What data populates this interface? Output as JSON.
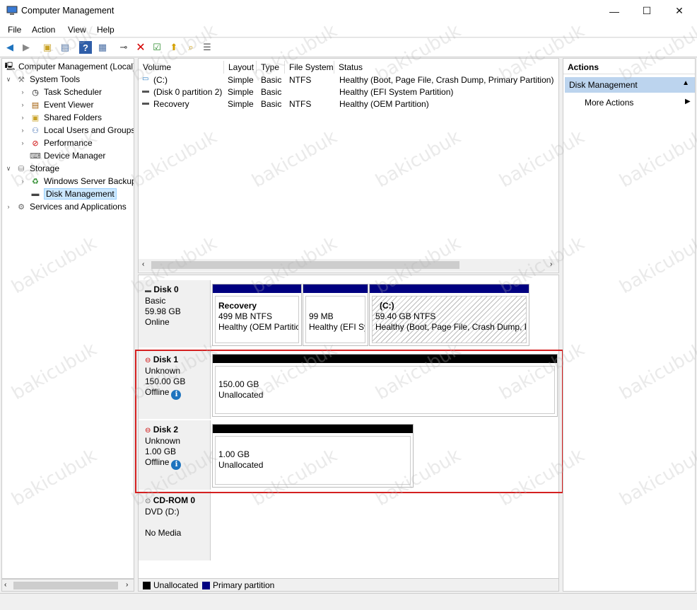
{
  "window": {
    "title": "Computer Management",
    "minimize": "—",
    "maximize": "☐",
    "close": "✕"
  },
  "menu": [
    "File",
    "Action",
    "View",
    "Help"
  ],
  "tree": {
    "root": "Computer Management (Local)",
    "system_tools": "System Tools",
    "task_scheduler": "Task Scheduler",
    "event_viewer": "Event Viewer",
    "shared_folders": "Shared Folders",
    "local_users": "Local Users and Groups",
    "performance": "Performance",
    "device_manager": "Device Manager",
    "storage": "Storage",
    "wsb": "Windows Server Backup",
    "disk_mgmt": "Disk Management",
    "services": "Services and Applications"
  },
  "columns": [
    "Volume",
    "Layout",
    "Type",
    "File System",
    "Status"
  ],
  "volumes": [
    {
      "name": "(C:)",
      "layout": "Simple",
      "type": "Basic",
      "fs": "NTFS",
      "status": "Healthy (Boot, Page File, Crash Dump, Primary Partition)"
    },
    {
      "name": "(Disk 0 partition 2)",
      "layout": "Simple",
      "type": "Basic",
      "fs": "",
      "status": "Healthy (EFI System Partition)"
    },
    {
      "name": "Recovery",
      "layout": "Simple",
      "type": "Basic",
      "fs": "NTFS",
      "status": "Healthy (OEM Partition)"
    }
  ],
  "disks": {
    "disk0": {
      "name": "Disk 0",
      "type": "Basic",
      "size": "59.98 GB",
      "state": "Online",
      "p1": {
        "name": "Recovery",
        "size": "499 MB NTFS",
        "status": "Healthy (OEM Partition)"
      },
      "p2": {
        "size": "99 MB",
        "status": "Healthy (EFI Sy"
      },
      "p3": {
        "name": "(C:)",
        "size": "59.40 GB NTFS",
        "status": "Healthy (Boot, Page File, Crash Dump, P"
      }
    },
    "disk1": {
      "name": "Disk 1",
      "type": "Unknown",
      "size": "150.00 GB",
      "state": "Offline",
      "p1": {
        "size": "150.00 GB",
        "status": "Unallocated"
      }
    },
    "disk2": {
      "name": "Disk 2",
      "type": "Unknown",
      "size": "1.00 GB",
      "state": "Offline",
      "p1": {
        "size": "1.00 GB",
        "status": "Unallocated"
      }
    },
    "cdrom": {
      "name": "CD-ROM 0",
      "type": "DVD (D:)",
      "state": "No Media"
    }
  },
  "legend": {
    "unallocated": "Unallocated",
    "primary": "Primary partition"
  },
  "actions": {
    "title": "Actions",
    "section": "Disk Management",
    "more": "More Actions"
  },
  "watermark": "bakicubuk",
  "colors": {
    "primary_bar": "#000080",
    "unalloc_bar": "#000000",
    "highlight_box": "#d42020",
    "selection": "#cce8ff"
  }
}
